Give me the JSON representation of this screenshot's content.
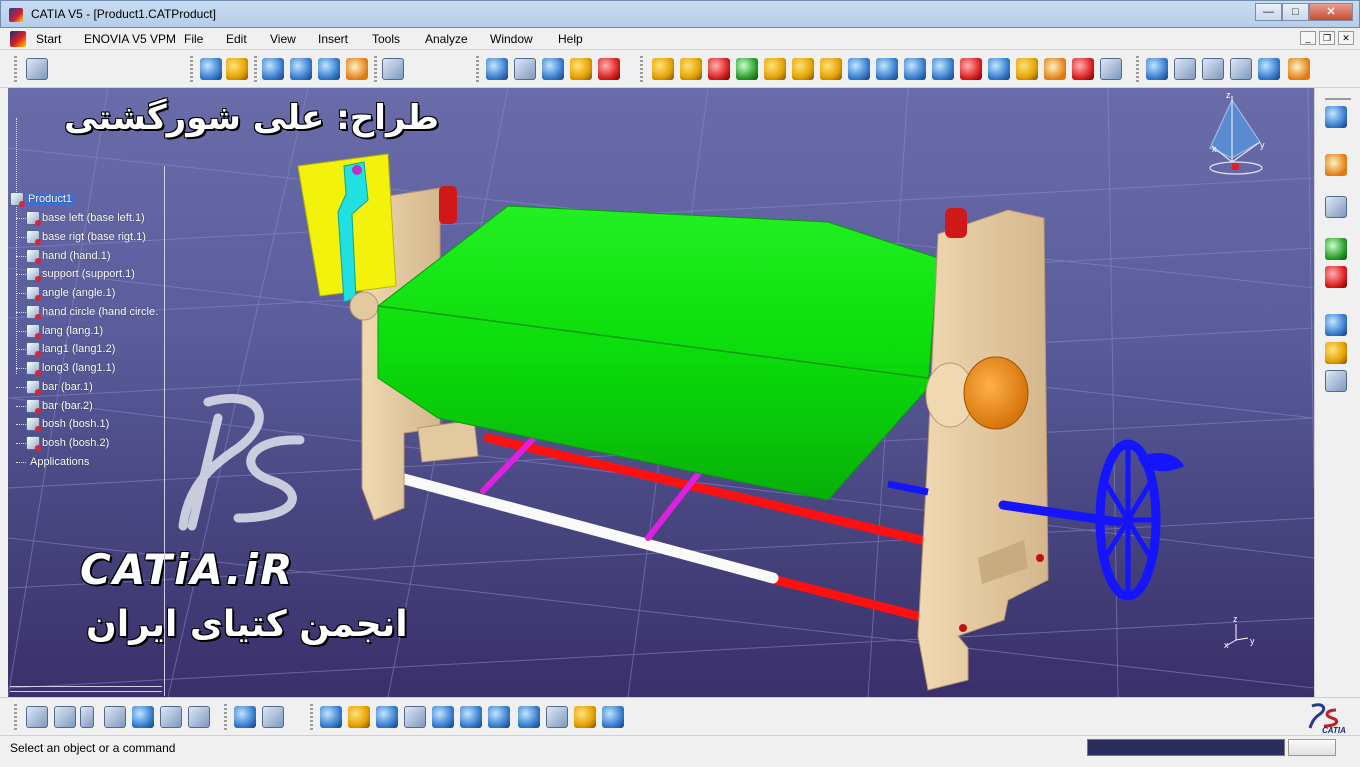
{
  "window": {
    "title": "CATIA V5 - [Product1.CATProduct]",
    "minimize": "—",
    "maximize": "□",
    "close": "✕"
  },
  "menu": {
    "items": [
      "Start",
      "ENOVIA V5 VPM",
      "File",
      "Edit",
      "View",
      "Insert",
      "Tools",
      "Analyze",
      "Window",
      "Help"
    ]
  },
  "tree": {
    "root": "Product1",
    "nodes": [
      "base left (base left.1)",
      "base rigt (base rigt.1)",
      "hand (hand.1)",
      "support (support.1)",
      "angle (angle.1)",
      "hand circle (hand circle.",
      "lang (lang.1)",
      "lang1 (lang1.2)",
      "long3 (lang1.1)",
      "bar (bar.1)",
      "bar (bar.2)",
      "bosh (bosh.1)",
      "bosh (bosh.2)"
    ],
    "applications": "Applications"
  },
  "watermark": {
    "designer": "طراح: علی شورگشتی",
    "site": "CATiA.iR",
    "subtitle": "انجمن کتیای ایران"
  },
  "compass": {
    "x": "x",
    "y": "y",
    "z": "z"
  },
  "status": {
    "text": "Select an object or a command"
  },
  "colors": {
    "viewport_top": "#6a6caa",
    "viewport_bottom": "#3a2f6a",
    "accent": "#3d6fd8",
    "roller": "#0ee60e",
    "frame": "#e3c9a0",
    "handwheel": "#1414ff",
    "bar_red": "#ff1010",
    "bar_magenta": "#e020e0",
    "knob": "#ff8c00"
  },
  "icons": {
    "top": [
      "product-icon",
      "rotate-icon",
      "update-icon",
      "snap-icon",
      "move-icon",
      "manipulate-icon",
      "explode-icon",
      "select-icon",
      "catalog-icon",
      "grid-icon",
      "bill-icon",
      "paint-icon",
      "hammer-icon",
      "assembly-icon",
      "component-icon",
      "part-icon",
      "constraint-icon",
      "bolt-icon",
      "contact-icon",
      "fix-icon",
      "offset-icon",
      "angle-icon",
      "fixtogether-icon",
      "quick-icon",
      "reuse-icon",
      "flexible-icon",
      "gear-icon",
      "cube-icon",
      "axis-icon",
      "measure-icon",
      "render-icon",
      "compass-icon",
      "zoom-icon",
      "section-icon",
      "light-icon"
    ],
    "right": [
      "fly-icon",
      "pointer-icon",
      "sketch-icon",
      "scene-icon",
      "spiral-icon",
      "catalog2-icon",
      "home-icon"
    ],
    "bottom": [
      "formula-icon",
      "comment-icon",
      "light-icon",
      "table-icon",
      "tree-icon",
      "lock-icon",
      "measure-icon",
      "publish-icon",
      "fly-icon",
      "fit-all-icon",
      "pan-icon",
      "rotate-icon",
      "zoom-in-icon",
      "zoom-out-icon",
      "normal-view-icon",
      "iso-view-icon",
      "shading-icon",
      "hide-show-icon",
      "swap-icon"
    ]
  }
}
